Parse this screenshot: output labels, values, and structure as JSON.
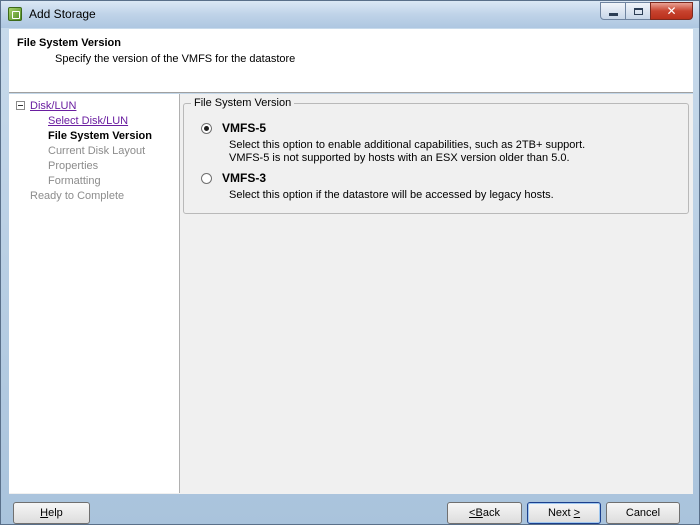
{
  "window": {
    "title": "Add Storage"
  },
  "header": {
    "title": "File System Version",
    "subtitle": "Specify the version of the VMFS for the datastore"
  },
  "nav": {
    "items": [
      {
        "label": "Disk/LUN",
        "state": "link"
      },
      {
        "label": "Select Disk/LUN",
        "state": "link"
      },
      {
        "label": "File System Version",
        "state": "current"
      },
      {
        "label": "Current Disk Layout",
        "state": "disabled"
      },
      {
        "label": "Properties",
        "state": "disabled"
      },
      {
        "label": "Formatting",
        "state": "disabled"
      },
      {
        "label": "Ready to Complete",
        "state": "disabled"
      }
    ]
  },
  "fs_version": {
    "group_label": "File System Version",
    "options": [
      {
        "label": "VMFS-5",
        "selected": true,
        "desc_line1": "Select this option to enable additional capabilities, such as 2TB+ support.",
        "desc_line2": "VMFS-5 is not supported by hosts with an ESX version older than 5.0."
      },
      {
        "label": "VMFS-3",
        "selected": false,
        "desc_line1": "Select this option if the datastore will be accessed by legacy hosts."
      }
    ]
  },
  "footer": {
    "help_key": "H",
    "help_rest": "elp",
    "back_arrow": "< ",
    "back_key": "B",
    "back_rest": "ack",
    "next_prefix": "Next ",
    "next_key": ">",
    "cancel_label": "Cancel"
  },
  "icons": {
    "app": "storage-wizard-icon",
    "minimize": "minimize-icon",
    "maximize": "maximize-icon",
    "close": "close-icon",
    "close_glyph": "✕"
  },
  "colors": {
    "link": "#6a1ea0",
    "disabled": "#8c8c8c",
    "close_button": "#c8432f"
  }
}
